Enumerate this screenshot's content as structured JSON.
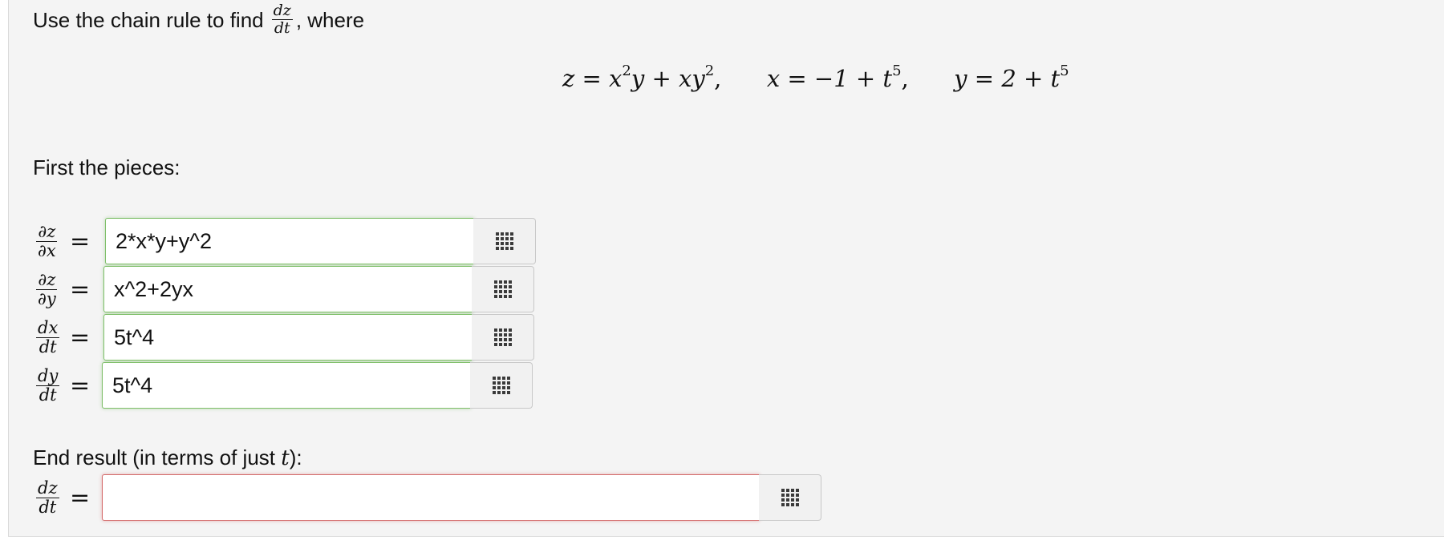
{
  "question": {
    "prefix": "Use the chain rule to find",
    "suffix": ", where",
    "frac_num": "dz",
    "frac_den": "dt"
  },
  "equation": {
    "z_lhs": "z",
    "z_rhs_a": "x",
    "z_rhs_b": "y + xy",
    "x_lhs": "x",
    "x_rhs": "−1 + t",
    "y_lhs": "y",
    "y_rhs": "2 + t",
    "exp2": "2",
    "exp5": "5"
  },
  "pieces_label": "First the pieces:",
  "rows": [
    {
      "num": "∂z",
      "den": "∂x",
      "value": "2*x*y+y^2"
    },
    {
      "num": "∂z",
      "den": "∂y",
      "value": "x^2+2yx"
    },
    {
      "num": "dx",
      "den": "dt",
      "value": "5t^4"
    },
    {
      "num": "dy",
      "den": "dt",
      "value": "5t^4"
    }
  ],
  "equals": "=",
  "end": {
    "label_prefix": "End result (in terms of just ",
    "label_var": "t",
    "label_suffix": "):",
    "num": "dz",
    "den": "dt",
    "value": ""
  },
  "icons": {
    "palette": "grid-icon"
  },
  "colors": {
    "valid_border": "#7fbf6a",
    "invalid_border": "#d46a6a",
    "panel_bg": "#f4f4f4"
  }
}
